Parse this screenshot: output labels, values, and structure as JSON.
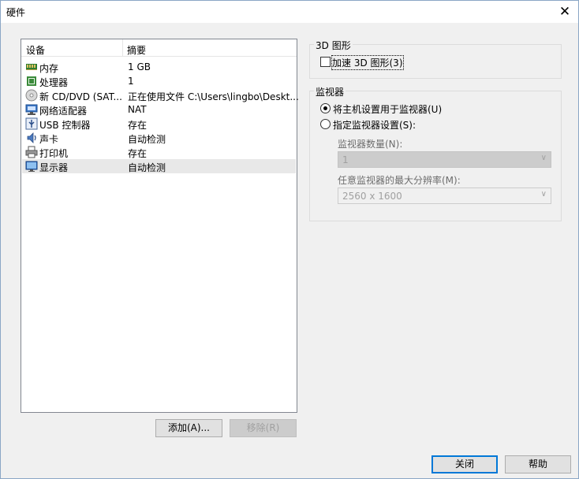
{
  "window": {
    "title": "硬件",
    "close_glyph": "✕"
  },
  "hardware_list": {
    "header": {
      "device": "设备",
      "summary": "摘要"
    },
    "items": [
      {
        "name": "内存",
        "summary": "1 GB",
        "icon": "memory-icon"
      },
      {
        "name": "处理器",
        "summary": "1",
        "icon": "processor-icon"
      },
      {
        "name": "新 CD/DVD (SAT...",
        "summary": "正在使用文件 C:\\Users\\lingbo\\Deskt...",
        "icon": "cd-dvd-icon"
      },
      {
        "name": "网络适配器",
        "summary": "NAT",
        "icon": "network-adapter-icon"
      },
      {
        "name": "USB 控制器",
        "summary": "存在",
        "icon": "usb-icon"
      },
      {
        "name": "声卡",
        "summary": "自动检测",
        "icon": "sound-card-icon"
      },
      {
        "name": "打印机",
        "summary": "存在",
        "icon": "printer-icon"
      },
      {
        "name": "显示器",
        "summary": "自动检测",
        "icon": "display-icon",
        "selected": true
      }
    ],
    "add_button": "添加(A)...",
    "remove_button": "移除(R)"
  },
  "graphics_3d": {
    "group_label": "3D 图形",
    "accelerate_label": "加速 3D 图形(3)",
    "accelerate_checked": false
  },
  "monitor": {
    "group_label": "监视器",
    "use_host_label": "将主机设置用于监视器(U)",
    "use_host_selected": true,
    "specify_label": "指定监视器设置(S):",
    "specify_selected": false,
    "count_label": "监视器数量(N):",
    "count_value": "1",
    "max_res_label": "任意监视器的最大分辨率(M):",
    "max_res_value": "2560 x 1600"
  },
  "footer": {
    "close_button": "关闭",
    "help_button": "帮助"
  },
  "colors": {
    "accent": "#0078d7",
    "window_border": "#8aa6c5"
  }
}
